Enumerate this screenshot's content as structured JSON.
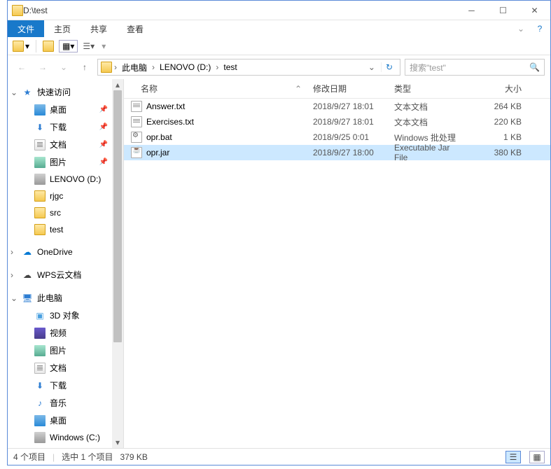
{
  "titlebar": {
    "title": "D:\\test"
  },
  "ribbon": {
    "file": "文件",
    "home": "主页",
    "share": "共享",
    "view": "查看"
  },
  "addr": {
    "root": "此电脑",
    "drive": "LENOVO (D:)",
    "folder": "test"
  },
  "search": {
    "placeholder": "搜索\"test\""
  },
  "cols": {
    "name": "名称",
    "date": "修改日期",
    "type": "类型",
    "size": "大小"
  },
  "files": [
    {
      "icon": "txt",
      "name": "Answer.txt",
      "date": "2018/9/27 18:01",
      "type": "文本文档",
      "size": "264 KB",
      "selected": false
    },
    {
      "icon": "txt",
      "name": "Exercises.txt",
      "date": "2018/9/27 18:01",
      "type": "文本文档",
      "size": "220 KB",
      "selected": false
    },
    {
      "icon": "bat",
      "name": "opr.bat",
      "date": "2018/9/25 0:01",
      "type": "Windows 批处理",
      "size": "1 KB",
      "selected": false
    },
    {
      "icon": "jar",
      "name": "opr.jar",
      "date": "2018/9/27 18:00",
      "type": "Executable Jar File",
      "size": "380 KB",
      "selected": true
    }
  ],
  "nav": {
    "quick": "快速访问",
    "desktop": "桌面",
    "download": "下载",
    "documents": "文档",
    "pictures": "图片",
    "lenovo": "LENOVO (D:)",
    "rjgc": "rjgc",
    "src": "src",
    "test": "test",
    "onedrive": "OneDrive",
    "wps": "WPS云文档",
    "thispc": "此电脑",
    "threed": "3D 对象",
    "video": "视频",
    "pic2": "图片",
    "doc2": "文档",
    "dl2": "下载",
    "music": "音乐",
    "desk2": "桌面",
    "winc": "Windows (C:)"
  },
  "status": {
    "count": "4 个项目",
    "selected": "选中 1 个项目",
    "size": "379 KB"
  }
}
